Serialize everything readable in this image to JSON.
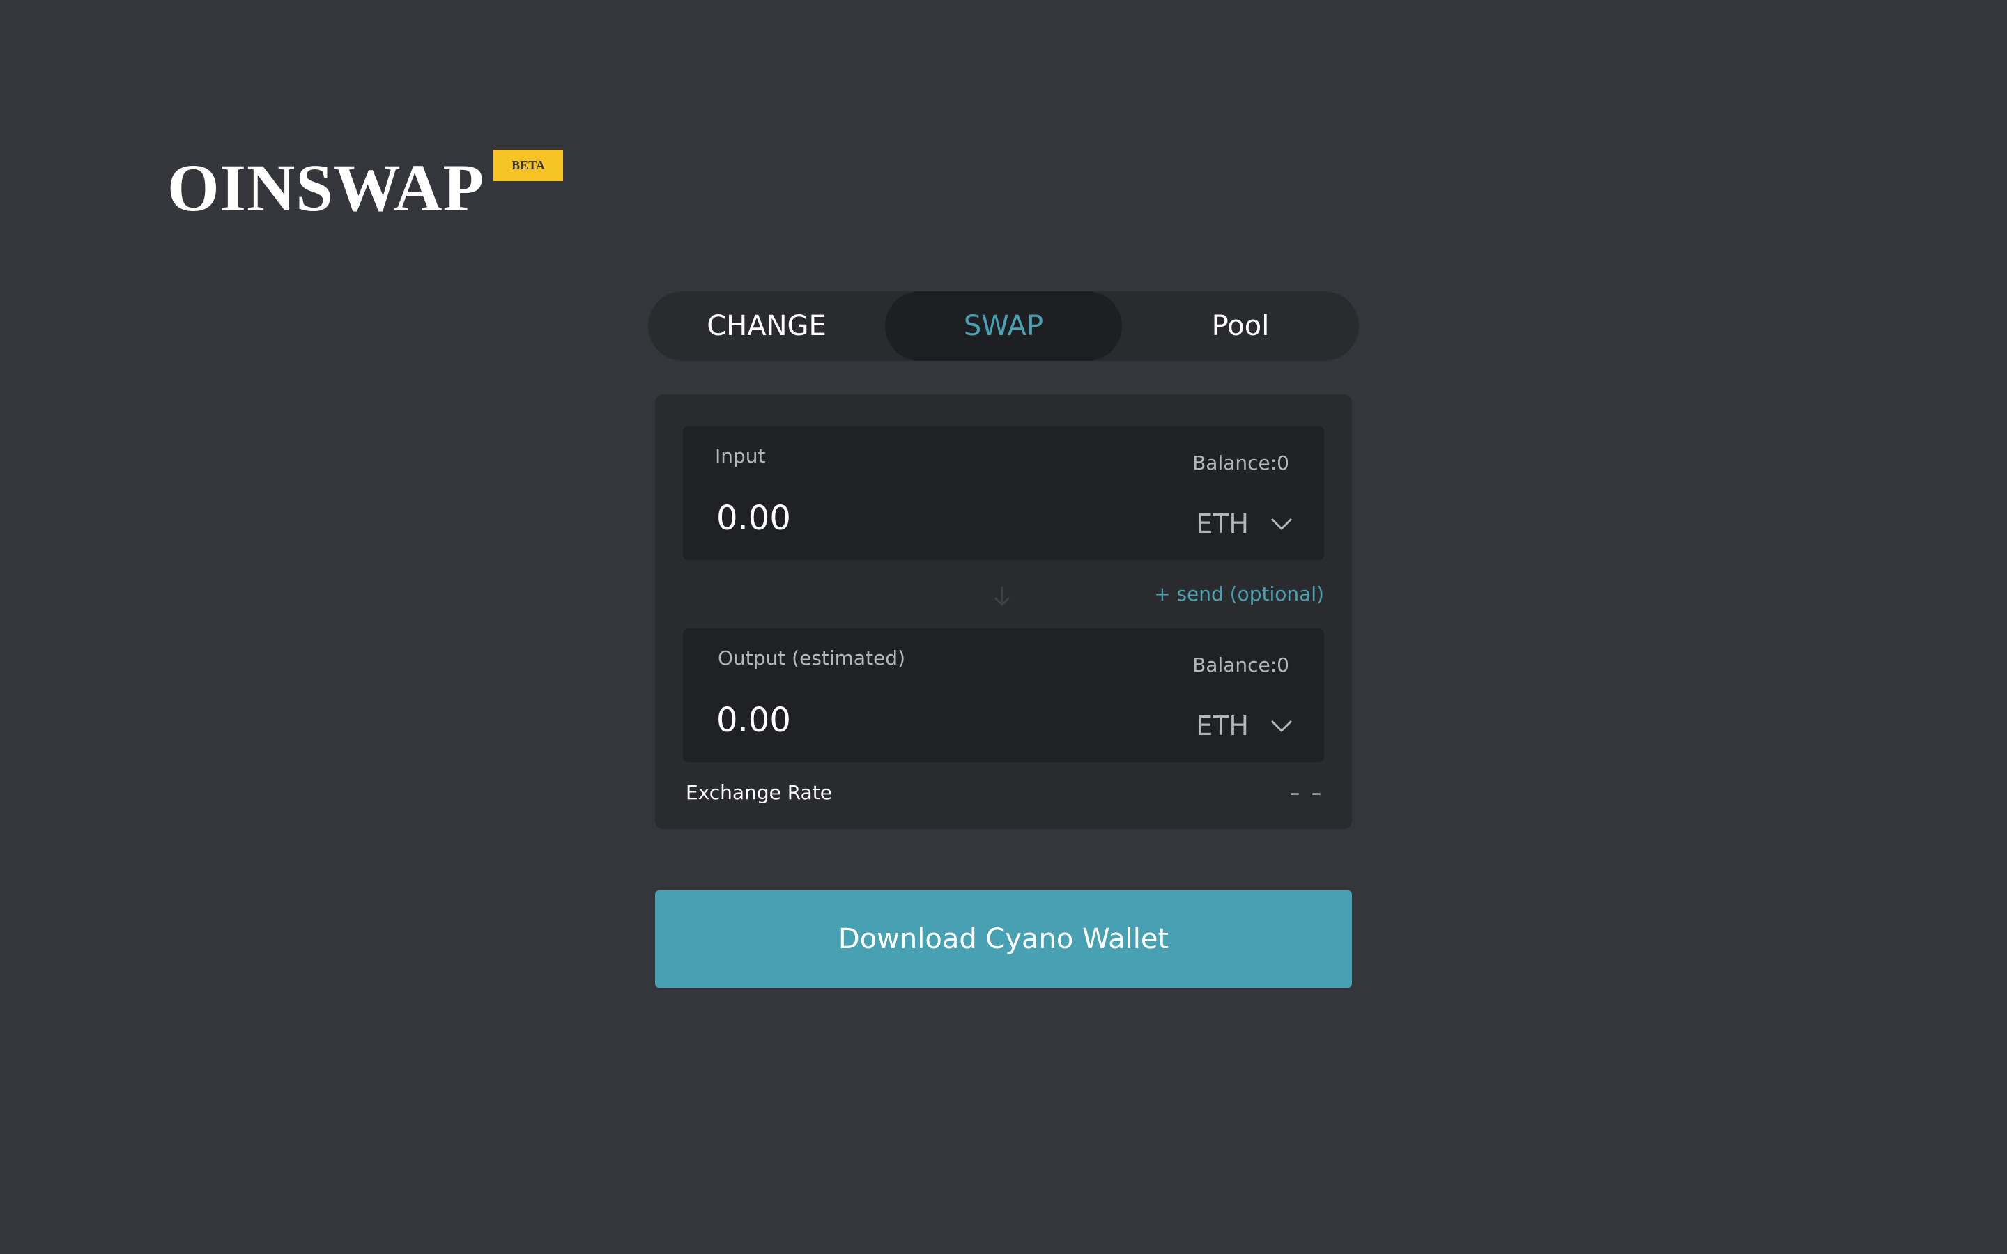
{
  "brand": {
    "logo_text": "OINSWAP",
    "badge": "BETA",
    "badge_color": "#f6c324"
  },
  "tabs": [
    {
      "label": "CHANGE",
      "active": false
    },
    {
      "label": "SWAP",
      "active": true
    },
    {
      "label": "Pool",
      "active": false
    }
  ],
  "swap": {
    "input": {
      "label": "Input",
      "balance": "Balance:0",
      "value": "0.00",
      "token": "ETH",
      "dropdown_icon": "chevron-down-icon"
    },
    "swap_direction_icon": "arrow-down-icon",
    "send_link": "+ send (optional)",
    "output": {
      "label": "Output (estimated)",
      "balance": "Balance:0",
      "value": "0.00",
      "token": "ETH",
      "dropdown_icon": "chevron-down-icon"
    },
    "exchange_rate": {
      "label": "Exchange Rate",
      "value": "– –"
    }
  },
  "actions": {
    "download_button": "Download Cyano Wallet"
  },
  "colors": {
    "background": "#35363b",
    "accent": "#4aa1b3",
    "button": "#47a1b2",
    "panel": "#2a2b2f",
    "field": "#202124"
  }
}
